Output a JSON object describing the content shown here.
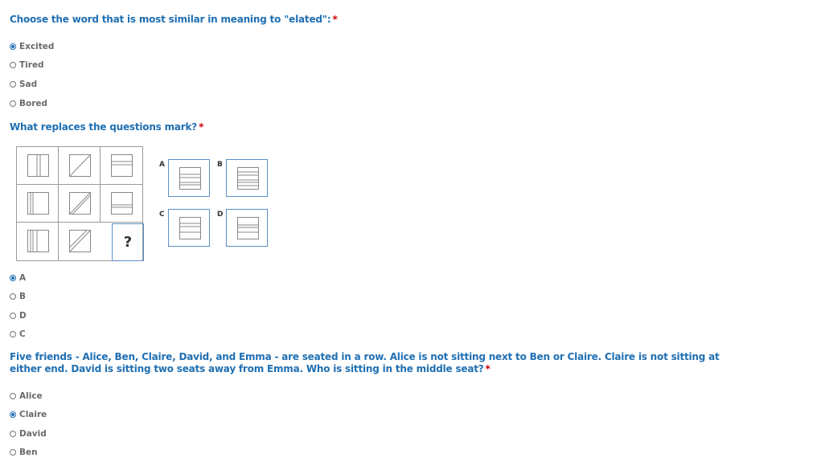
{
  "q1": {
    "title": "Choose the word that is most similar in meaning to \"elated\":",
    "required": "*",
    "options": [
      "Excited",
      "Tired",
      "Sad",
      "Bored"
    ],
    "selected": "Excited"
  },
  "q2": {
    "title": "What replaces the questions mark?",
    "required": "*",
    "puzzle_missing": "?",
    "answer_labels": [
      "A",
      "B",
      "C",
      "D"
    ],
    "options": [
      "A",
      "B",
      "D",
      "C"
    ],
    "selected": "A"
  },
  "q3": {
    "title_line1": "Five friends - Alice, Ben, Claire, David, and Emma - are seated in a row. Alice is not sitting next to Ben or Claire. Claire is not sitting at",
    "title_line2": "either end. David is sitting two seats away from Emma. Who is sitting in the middle seat?",
    "required": "*",
    "options": [
      "Alice",
      "Claire",
      "David",
      "Ben"
    ],
    "selected": "Claire"
  },
  "colors": {
    "accent": "#1f6fb2",
    "required": "#cc0000",
    "option_text": "#6a6a6a"
  }
}
